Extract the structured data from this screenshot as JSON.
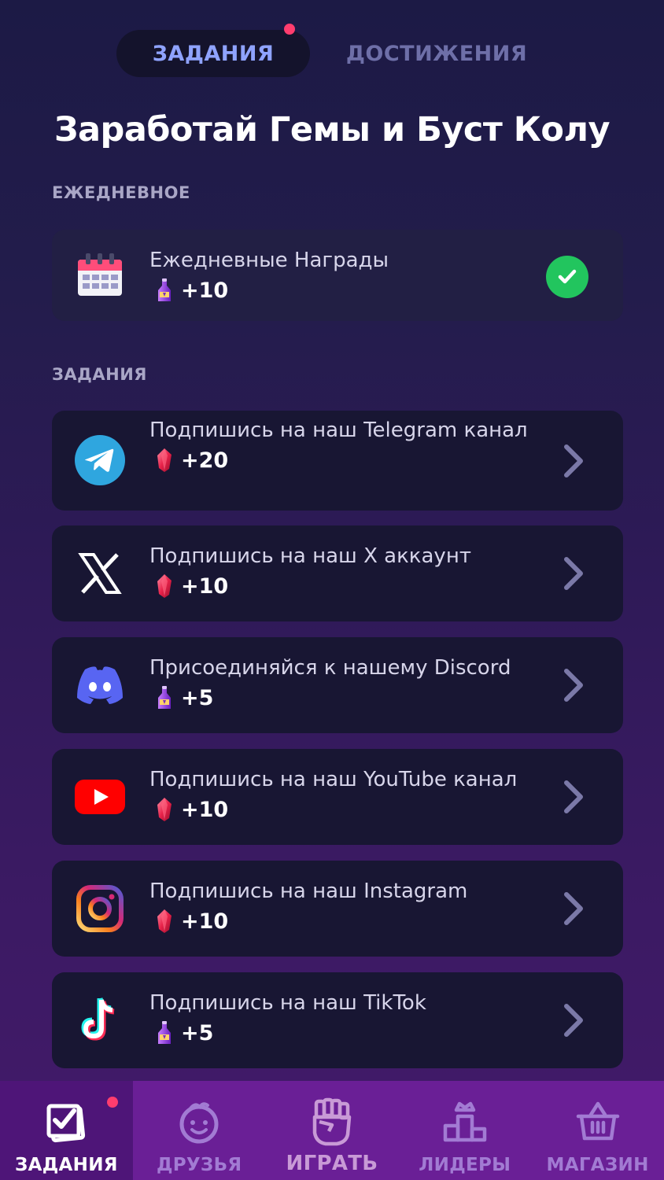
{
  "tabs": {
    "active_label": "ЗАДАНИЯ",
    "inactive_label": "ДОСТИЖЕНИЯ"
  },
  "title": "Заработай Гемы и Буст Колу",
  "sections": {
    "daily_label": "ЕЖЕДНЕВНОЕ",
    "tasks_label": "ЗАДАНИЯ"
  },
  "daily": {
    "title": "Ежедневные Награды",
    "reward": "+10",
    "reward_icon": "cola-bottle-icon",
    "status": "completed",
    "icon": "calendar-icon"
  },
  "tasks": [
    {
      "title": "Подпишись на наш Telegram канал",
      "reward": "+20",
      "reward_icon": "gem-icon",
      "icon": "telegram-icon"
    },
    {
      "title": "Подпишись на наш X аккаунт",
      "reward": "+10",
      "reward_icon": "gem-icon",
      "icon": "x-logo-icon"
    },
    {
      "title": "Присоединяйся к нашему Discord",
      "reward": "+5",
      "reward_icon": "cola-bottle-icon",
      "icon": "discord-icon"
    },
    {
      "title": "Подпишись на наш YouTube канал",
      "reward": "+10",
      "reward_icon": "gem-icon",
      "icon": "youtube-icon"
    },
    {
      "title": "Подпишись на наш Instagram",
      "reward": "+10",
      "reward_icon": "gem-icon",
      "icon": "instagram-icon"
    },
    {
      "title": "Подпишись на наш TikTok",
      "reward": "+5",
      "reward_icon": "cola-bottle-icon",
      "icon": "tiktok-icon"
    }
  ],
  "nav": [
    {
      "label": "ЗАДАНИЯ",
      "icon": "tasks-checkbox-icon",
      "active": true
    },
    {
      "label": "ДРУЗЬЯ",
      "icon": "friends-face-icon",
      "active": false
    },
    {
      "label": "ИГРАТЬ",
      "icon": "fist-icon",
      "active": false
    },
    {
      "label": "ЛИДЕРЫ",
      "icon": "podium-icon",
      "active": false
    },
    {
      "label": "МАГАЗИН",
      "icon": "basket-icon",
      "active": false
    }
  ],
  "colors": {
    "accent_tab": "#8fa3ff",
    "notification_dot": "#ff3d6e",
    "check_green": "#22c55e",
    "nav_background": "#6a1f96"
  }
}
